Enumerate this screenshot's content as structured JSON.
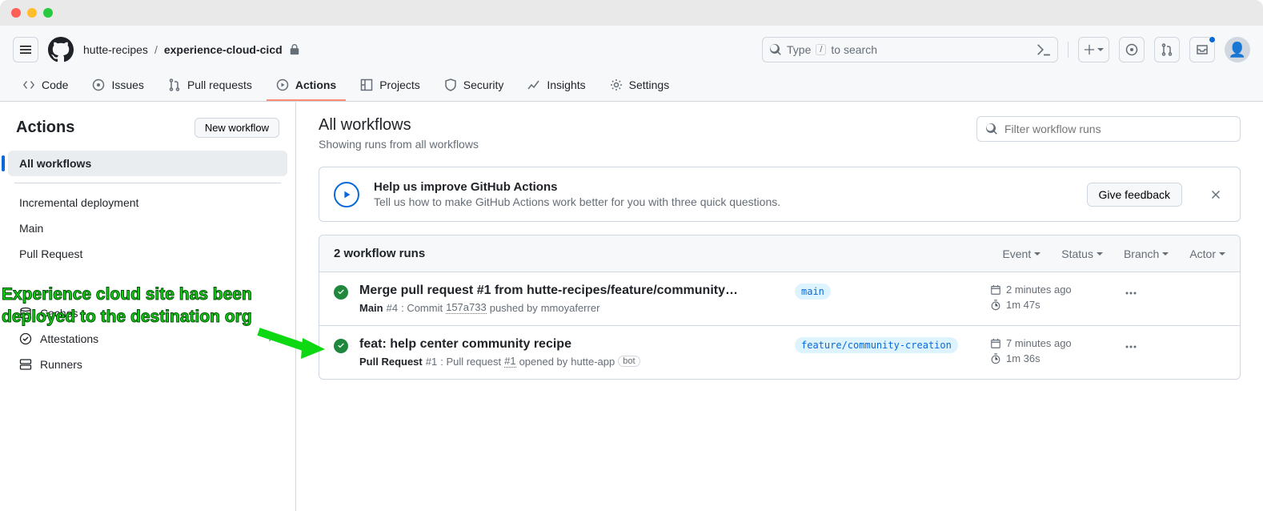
{
  "breadcrumb": {
    "owner": "hutte-recipes",
    "repo": "experience-cloud-cicd"
  },
  "search": {
    "prefix": "Type",
    "key": "/",
    "suffix": "to search"
  },
  "repo_tabs": {
    "code": "Code",
    "issues": "Issues",
    "pulls": "Pull requests",
    "actions": "Actions",
    "projects": "Projects",
    "security": "Security",
    "insights": "Insights",
    "settings": "Settings"
  },
  "sidebar": {
    "title": "Actions",
    "new_workflow": "New workflow",
    "all": "All workflows",
    "workflows": [
      "Incremental deployment",
      "Main",
      "Pull Request"
    ],
    "caches": "Caches",
    "attestations": "Attestations",
    "runners": "Runners"
  },
  "main": {
    "title": "All workflows",
    "subtitle": "Showing runs from all workflows",
    "filter_placeholder": "Filter workflow runs"
  },
  "banner": {
    "title": "Help us improve GitHub Actions",
    "text": "Tell us how to make GitHub Actions work better for you with three quick questions.",
    "button": "Give feedback"
  },
  "runs": {
    "count_label": "2 workflow runs",
    "filters": {
      "event": "Event",
      "status": "Status",
      "branch": "Branch",
      "actor": "Actor"
    },
    "items": [
      {
        "title": "Merge pull request #1 from hutte-recipes/feature/community…",
        "workflow": "Main",
        "run_no": "#4",
        "mid1": ": Commit ",
        "commit": "157a733",
        "mid2": " pushed by ",
        "actor": "mmoyaferrer",
        "pr": "",
        "bot": "",
        "branch": "main",
        "time": "2 minutes ago",
        "duration": "1m 47s"
      },
      {
        "title": "feat: help center community recipe",
        "workflow": "Pull Request",
        "run_no": "#1",
        "mid1": ": Pull request ",
        "commit": "",
        "pr": "#1",
        "mid2": " opened by ",
        "actor": "hutte-app",
        "bot": "bot",
        "branch": "feature/community-creation",
        "time": "7 minutes ago",
        "duration": "1m 36s"
      }
    ]
  },
  "annotation": {
    "line1": "Experience cloud site has been",
    "line2": "deployed to the destination org"
  }
}
